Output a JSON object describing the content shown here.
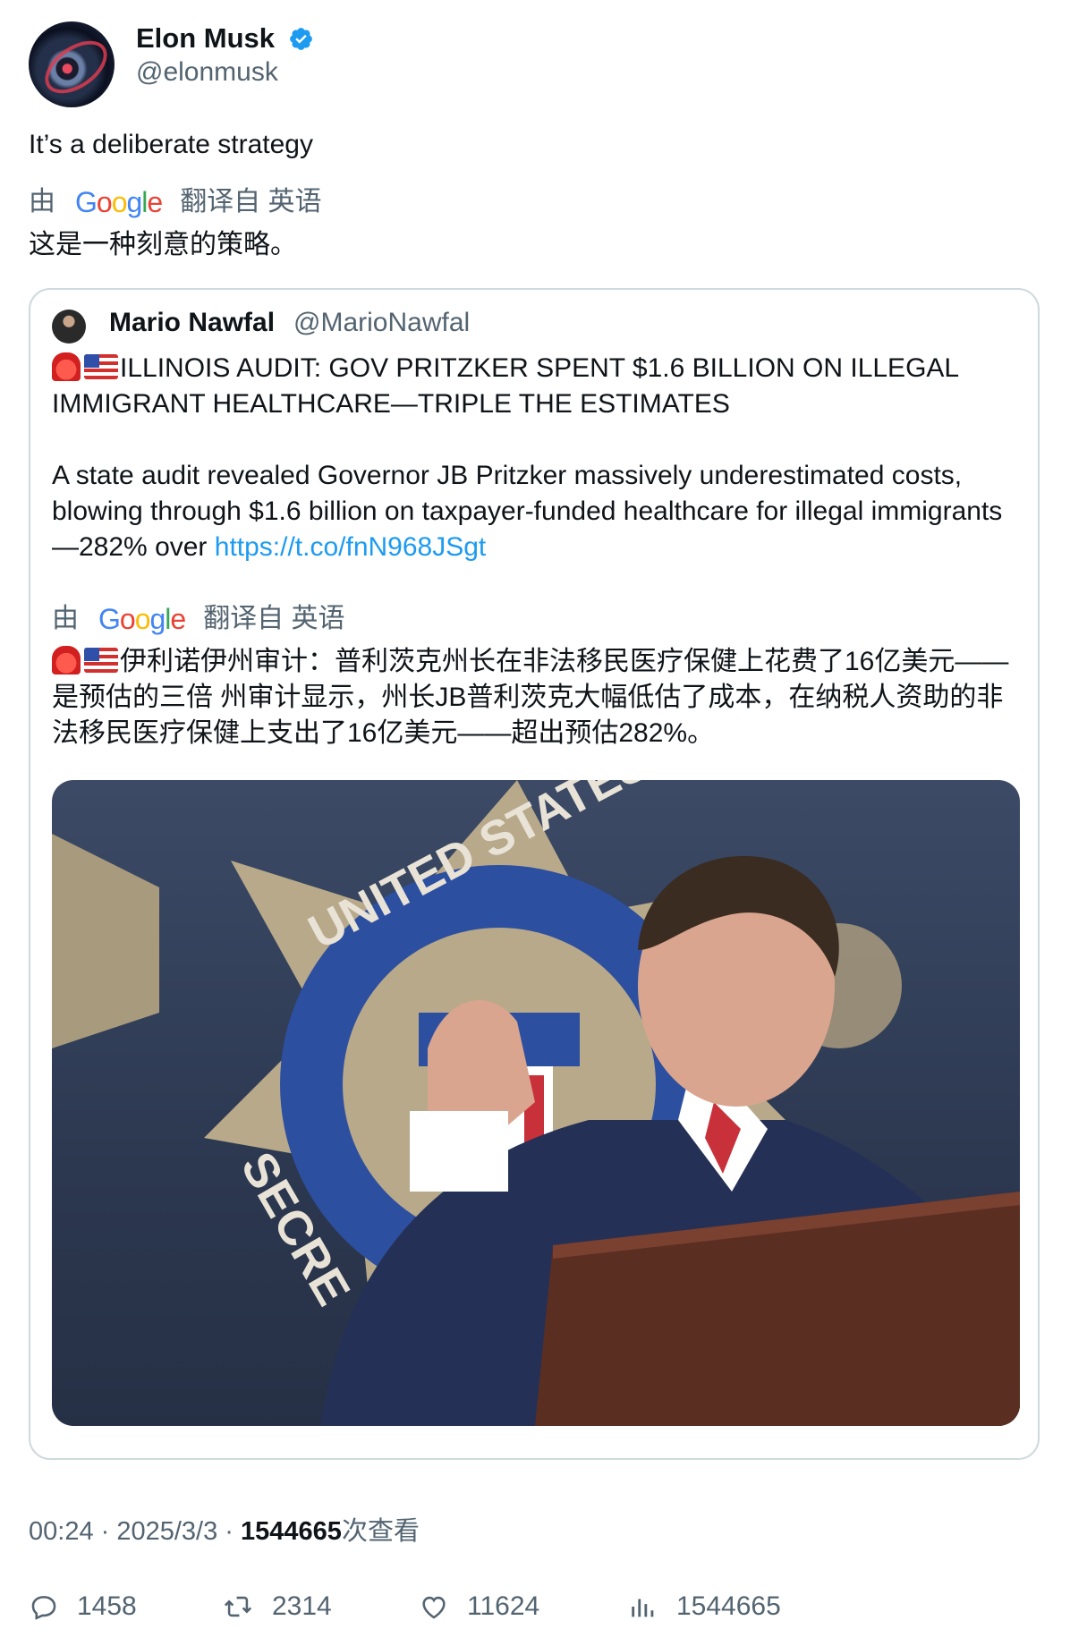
{
  "author": {
    "name": "Elon Musk",
    "handle": "@elonmusk",
    "verified_color": "#1d9bf0"
  },
  "tweet": {
    "text": "It’s a deliberate strategy",
    "translation": {
      "by": "由",
      "provider": "Google",
      "from_label": "翻译自 英语",
      "text": "这是一种刻意的策略。"
    }
  },
  "quote": {
    "name": "Mario Nawfal",
    "handle": "@MarioNawfal",
    "headline": "ILLINOIS AUDIT: GOV PRITZKER SPENT $1.6 BILLION ON ILLEGAL IMMIGRANT HEALTHCARE—TRIPLE THE ESTIMATES",
    "body": "A state audit revealed Governor JB Pritzker massively underestimated costs, blowing through $1.6 billion on taxpayer-funded healthcare for illegal immigrants—282% over ",
    "link": "https://t.co/fnN968JSgt",
    "translation": {
      "by": "由",
      "provider": "Google",
      "from_label": "翻译自 英语",
      "text": "伊利诺伊州审计：普利茨克州长在非法移民医疗保健上花费了16亿美元——是预估的三倍 州审计显示，州长JB普利茨克大幅低估了成本，在纳税人资助的非法移民医疗保健上支出了16亿美元——超出预估282%。"
    },
    "image": {
      "badge_text_top": "UNITED STATES",
      "badge_text_side": "SECRE"
    }
  },
  "meta": {
    "time": "00:24",
    "sep": " · ",
    "date": "2025/3/3",
    "views_count": "1544665",
    "views_label": "次查看"
  },
  "stats": {
    "replies": "1458",
    "retweets": "2314",
    "likes": "11624",
    "views": "1544665"
  },
  "icons": [
    "verified-badge-icon",
    "google-logo",
    "reply-icon",
    "retweet-icon",
    "like-icon",
    "views-icon",
    "siren-emoji",
    "us-flag-emoji"
  ],
  "colors": {
    "text": "#0f1419",
    "secondary": "#536471",
    "link": "#1d9bf0",
    "border": "#cfd9de"
  }
}
